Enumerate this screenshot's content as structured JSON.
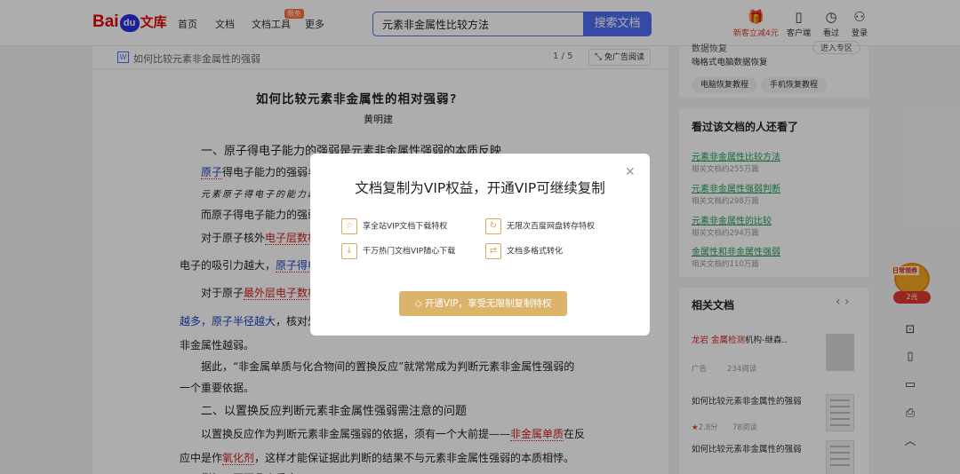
{
  "header": {
    "logo_left": "Bai",
    "logo_mid": "du",
    "logo_right": "文库",
    "nav": [
      "首页",
      "文档",
      "文档工具",
      "更多"
    ],
    "nav_badge": "限免",
    "search_value": "元素非金属性比较方法",
    "search_button": "搜索文档",
    "gift_label": "新客立减4元",
    "service_label": "客户端",
    "history_label": "看过",
    "login_label": "登录"
  },
  "doc": {
    "bar_title": "如何比较元素非金属性的强弱",
    "page_indicator": "1 / 5",
    "noad_label": "免广告阅读",
    "title": "如何比较元素非金属性的相对强弱?",
    "author": "黄明建",
    "h1": "一、原子得电子能力的强弱是元素非金属性强弱的本质反映",
    "l1a": "原子",
    "l1b": "得电子能力的强弱与",
    "l2": "元素原子得电子的能力越",
    "l3": "而原子得电子能力的强弱",
    "l4a": "对于原子核外",
    "l4b": "电子层数相",
    "l5a": "电子的吸引力越大，",
    "l5b": "原子得电",
    "l6a": "对于原子",
    "l6b": "最外层电子数相",
    "l7a": "越多，原子半径越大",
    "l7b": "，核对外",
    "l8": "非金属性越弱。",
    "l9": "据此，“非金属单质与化合物间的置换反应”就常常成为判断元素非金属性强弱的",
    "l10": "一个重要依据。",
    "h2": "二、以置换反应判断元素非金属性强弱需注意的问题",
    "l11a": "以置换反应作为判断元素非金属强弱的依据，须有一个大前提——",
    "l11b": "非金属单质",
    "l11c": "在反",
    "l12a": "应中是作",
    "l12b": "氧化剂",
    "l12c": "，这样才能保证据此判断的结果不与元素非金属性强弱的本质相悖。",
    "l13": "例如，下面几个反应"
  },
  "sidebar": {
    "top_partial": "数据恢复",
    "top_button": "进入专区",
    "top_line": "嗨格式电脑数据恢复",
    "tags": [
      "电脑恢复教程",
      "手机恢复教程"
    ],
    "viewed_head": "看过该文档的人还看了",
    "viewed": [
      {
        "title": "元素非金属性比较方法",
        "meta": "相关文档约255万篇"
      },
      {
        "title": "元素非金属性强弱判断",
        "meta": "相关文档约298万篇"
      },
      {
        "title": "元素非金属性的比较",
        "meta": "相关文档约294万篇"
      },
      {
        "title": "金属性和非金属性强弱",
        "meta": "相关文档约110万篇"
      }
    ],
    "related_head": "相关文档",
    "related_nav": "‹ ›",
    "rel1_title_a": "龙岩 金属检测",
    "rel1_title_b": "机构-继森..",
    "rel1_ad": "广告",
    "rel1_reads": "234阅读",
    "rel2_title": "如何比较元素非金属性的强弱",
    "rel2_rating": "2.8分",
    "rel2_reads": "78阅读",
    "rel3_title": "如何比较元素非金属性的强弱"
  },
  "coupon": {
    "label": "日常领券",
    "amount": "2元"
  },
  "modal": {
    "title": "文档复制为VIP权益，开通VIP可继续复制",
    "perks": [
      "享全站VIP文档下载特权",
      "无限次百度网盘转存特权",
      "千万热门文档VIP随心下载",
      "文档多格式转化"
    ],
    "button": "开通VIP，享受无限制复制特权"
  }
}
